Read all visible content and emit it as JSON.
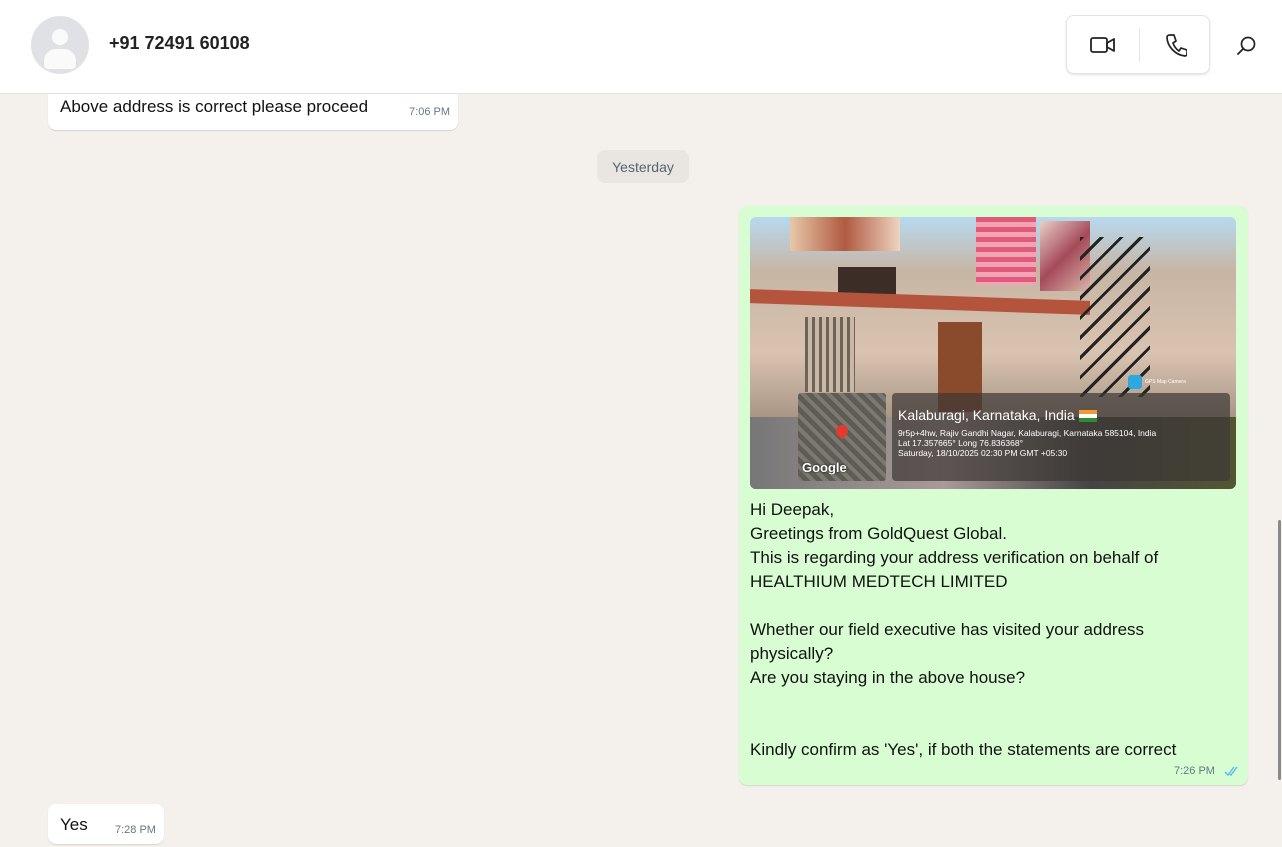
{
  "header": {
    "contact_name": "+91 72491 60108",
    "icons": [
      "video-call-icon",
      "voice-call-icon",
      "search-icon"
    ]
  },
  "messages": [
    {
      "direction": "in",
      "text": "Above address is correct please proceed",
      "time": "7:06 PM"
    },
    {
      "type": "date_divider",
      "text": "Yesterday"
    },
    {
      "direction": "out",
      "image": {
        "location": "Kalaburagi, Karnataka, India",
        "address": "9r5p+4hw, Rajiv Gandhi Nagar, Kalaburagi, Karnataka 585104, India",
        "coords": "Lat 17.357665° Long 76.836368°",
        "datetime": "Saturday, 18/10/2025 02:30 PM GMT +05:30",
        "map_label": "Google",
        "app_label": "GPS Map Camera"
      },
      "text": "Hi Deepak,\nGreetings from GoldQuest Global.\nThis is regarding your address verification on behalf of HEALTHIUM MEDTECH LIMITED\n\nWhether our field executive has visited your address physically?\nAre you staying in the above house?\n\n\nKindly confirm as 'Yes', if both the statements are correct",
      "time": "7:26 PM",
      "status": "read"
    },
    {
      "direction": "in",
      "text": "Yes",
      "time": "7:28 PM"
    }
  ],
  "colors": {
    "outgoing": "#d9fdd3",
    "incoming": "#ffffff",
    "read_tick": "#53bdeb"
  }
}
